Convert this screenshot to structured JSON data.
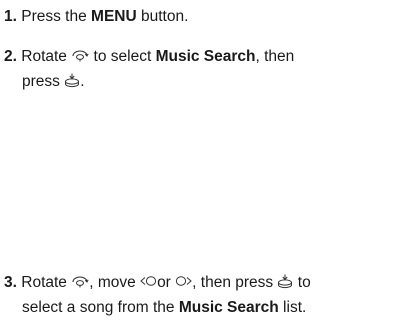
{
  "steps": [
    {
      "number": "1.",
      "t1": "Press the ",
      "b1": "MENU",
      "t2": " button."
    },
    {
      "number": "2.",
      "t1": "Rotate",
      "t2": "to select ",
      "b1": "Music Search",
      "t3": ", then",
      "t4": "press",
      "t5": "."
    },
    {
      "number": "3.",
      "t1": "Rotate",
      "t2": ", move",
      "t3": "or",
      "t4": ", then press",
      "t5": "to",
      "t6": "select a song from the ",
      "b1": "Music Search",
      "t7": " list."
    }
  ],
  "icons": {
    "rotate": "interface-dial-rotate-icon",
    "press": "interface-dial-press-icon",
    "move_left": "interface-dial-move-left-icon",
    "move_right": "interface-dial-move-right-icon"
  }
}
